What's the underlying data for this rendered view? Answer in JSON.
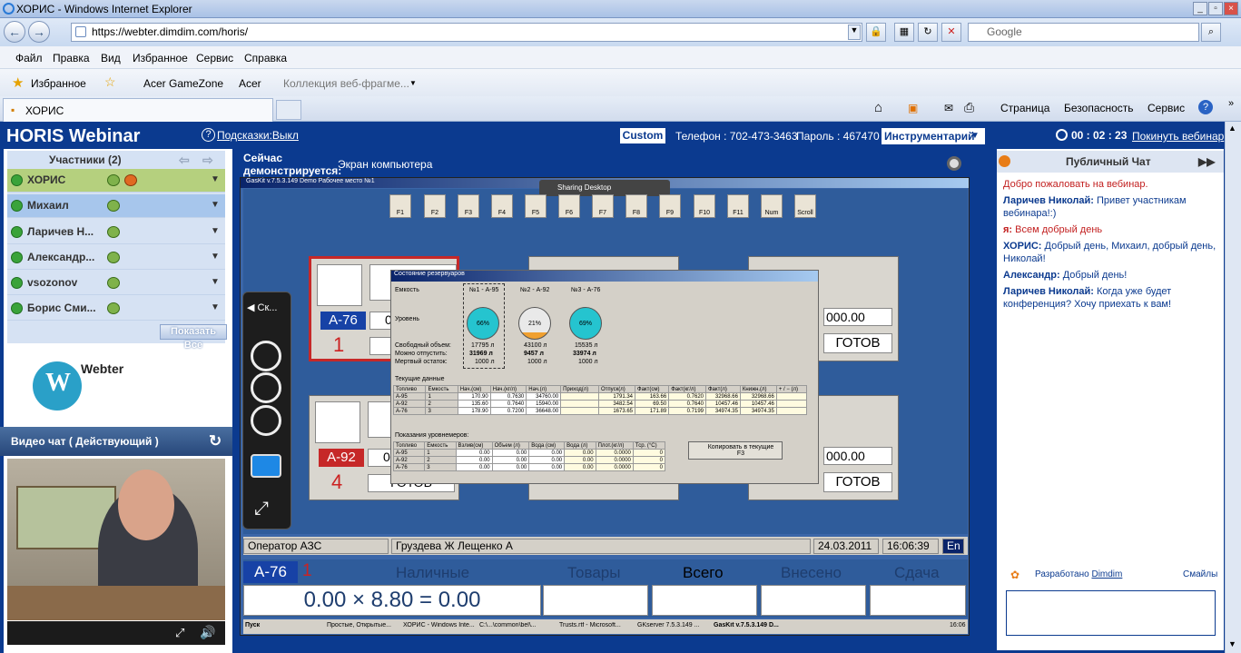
{
  "browser": {
    "window_title": "ХОРИС - Windows Internet Explorer",
    "address": "https://webter.dimdim.com/horis/",
    "search_placeholder": "Google",
    "menu": [
      "Файл",
      "Правка",
      "Вид",
      "Избранное",
      "Сервис",
      "Справка"
    ],
    "favorites_label": "Избранное",
    "fav_links": [
      "Acer GameZone",
      "Acer",
      "Коллекция веб-фрагме..."
    ],
    "tab_title": "ХОРИС",
    "tab_tools": [
      "Страница",
      "Безопасность",
      "Сервис"
    ]
  },
  "webinar": {
    "brand": "HORIS Webinar",
    "hints": "Подсказки:Выкл",
    "custom_label": "Custom",
    "phone": "Телефон : 702-473-3463",
    "password": "Пароль : 467470",
    "tools_select": "Инструментарий",
    "timer": "00 : 02 : 23",
    "leave": "Покинуть вебинар"
  },
  "participants": {
    "title": "Участники  (2)",
    "items": [
      {
        "name": "ХОРИС"
      },
      {
        "name": "Михаил"
      },
      {
        "name": "Ларичев Н..."
      },
      {
        "name": "Александр..."
      },
      {
        "name": "vsozonov"
      },
      {
        "name": "Борис Сми..."
      }
    ],
    "show_all": "Показать Все"
  },
  "logo_text": "Webter",
  "video": {
    "title": "Видео чат ( Действующий )"
  },
  "share": {
    "now_label": "Сейчас демонстрируется:",
    "now_value": "Экран компьютера",
    "sharing_label": "Sharing Desktop",
    "zoom_label": "Ск...",
    "app_title": "GasKit v.7.5.3.149  Demo      Рабочее место №1",
    "fkeys": [
      "F1",
      "F2",
      "F3",
      "F4",
      "F5",
      "F6",
      "F7",
      "F8",
      "F9",
      "F10",
      "F11",
      "Num",
      "Scroll"
    ],
    "pumps": [
      {
        "fuel": "А-76",
        "no": "1",
        "amount": "0"
      },
      {
        "fuel": "А-92",
        "no": "4",
        "amount": "0",
        "status": "ГОТОВ"
      }
    ],
    "right_pumps": [
      {
        "amount": "000.00",
        "status": "ГОТОВ"
      },
      {
        "amount": "000.00",
        "status": "ГОТОВ"
      }
    ],
    "dialog": {
      "title": "Состояние резервуаров",
      "row_labels": [
        "Емкость",
        "Уровень",
        "Свободный объем:",
        "Можно отпустить:",
        "Мертвый остаток:"
      ],
      "tanks": [
        {
          "name": "№1 - А-95",
          "level": "66%",
          "free": "17795 л",
          "release": "31969 л",
          "dead": "1000 л"
        },
        {
          "name": "№2 - А-92",
          "level": "21%",
          "free": "43100 л",
          "release": "9457 л",
          "dead": "1000 л"
        },
        {
          "name": "№3 - А-76",
          "level": "69%",
          "free": "15535 л",
          "release": "33974 л",
          "dead": "1000 л"
        }
      ],
      "current_label": "Текущие данные",
      "cur_headers": [
        "Топливо",
        "Емкость",
        "Нач.(см)",
        "Нач.(кг/л)",
        "Нач.(л)",
        "Приход(л)",
        "Отпуск(л)",
        "Факт(см)",
        "Факт(кг/л)",
        "Факт(л)",
        "Книжн.(л)",
        "+ / − (л)"
      ],
      "cur_rows": [
        [
          "А-95",
          "1",
          "170.90",
          "0.7630",
          "34760.00",
          "",
          "1791.34",
          "163.66",
          "0.7620",
          "32968.66",
          "32968.66",
          ""
        ],
        [
          "А-92",
          "2",
          "135.60",
          "0.7640",
          "15940.00",
          "",
          "3482.54",
          "69.50",
          "0.7640",
          "10457.46",
          "10457.46",
          ""
        ],
        [
          "А-76",
          "3",
          "178.90",
          "0.7200",
          "36648.00",
          "",
          "1673.65",
          "171.89",
          "0.7199",
          "34974.35",
          "34974.35",
          ""
        ]
      ],
      "gauge_label": "Показания уровнемеров:",
      "gauge_headers": [
        "Топливо",
        "Емкость",
        "Взлив(см)",
        "Объем (л)",
        "Вода (см)",
        "Вода (л)",
        "Плот.(кг/л)",
        "Тср. (°C)"
      ],
      "gauge_rows": [
        [
          "А-95",
          "1",
          "0.00",
          "0.00",
          "0.00",
          "0.00",
          "0.0000",
          "0"
        ],
        [
          "А-92",
          "2",
          "0.00",
          "0.00",
          "0.00",
          "0.00",
          "0.0000",
          "0"
        ],
        [
          "А-76",
          "3",
          "0.00",
          "0.00",
          "0.00",
          "0.00",
          "0.0000",
          "0"
        ]
      ],
      "copy_btn": "Копировать в текущие",
      "copy_key": "F3"
    },
    "status": {
      "operator": "Оператор АЗС",
      "names": "Груздева Ж Лещенко А",
      "date": "24.03.2011",
      "time": "16:06:39",
      "lang": "En"
    },
    "cash": {
      "fuel": "А-76",
      "no": "1",
      "labels": [
        "Наличные",
        "Товары",
        "Всего",
        "Внесено",
        "Сдача"
      ],
      "formula": "0.00 × 8.80 = 0.00"
    },
    "taskbar": [
      "Пуск",
      "Простые, Открытые...",
      "ХОРИС - Windows Inte...",
      "C:\\...\\common\\bel\\...",
      "Trusts.rtf - Microsoft...",
      "GKserver 7.5.3.149 ...",
      "GasKit v.7.5.3.149 D...",
      "16:06"
    ]
  },
  "chat": {
    "title": "Публичный Чат",
    "messages": [
      {
        "who": "",
        "text": "Добро пожаловать на вебинар."
      },
      {
        "who": "Ларичев Николай:",
        "text": " Привет участникам вебинара!:)"
      },
      {
        "who": "я:",
        "text": " Всем добрый день"
      },
      {
        "who": "ХОРИС:",
        "text": " Добрый день, Михаил, добрый день, Николай!"
      },
      {
        "who": "Александр:",
        "text": " Добрый день!"
      },
      {
        "who": "Ларичев Николай:",
        "text": " Когда уже будет конференция? Хочу приехать к вам!"
      }
    ],
    "developed": "Разработано",
    "dimdim": "Dimdim",
    "smiles": "Смайлы"
  }
}
